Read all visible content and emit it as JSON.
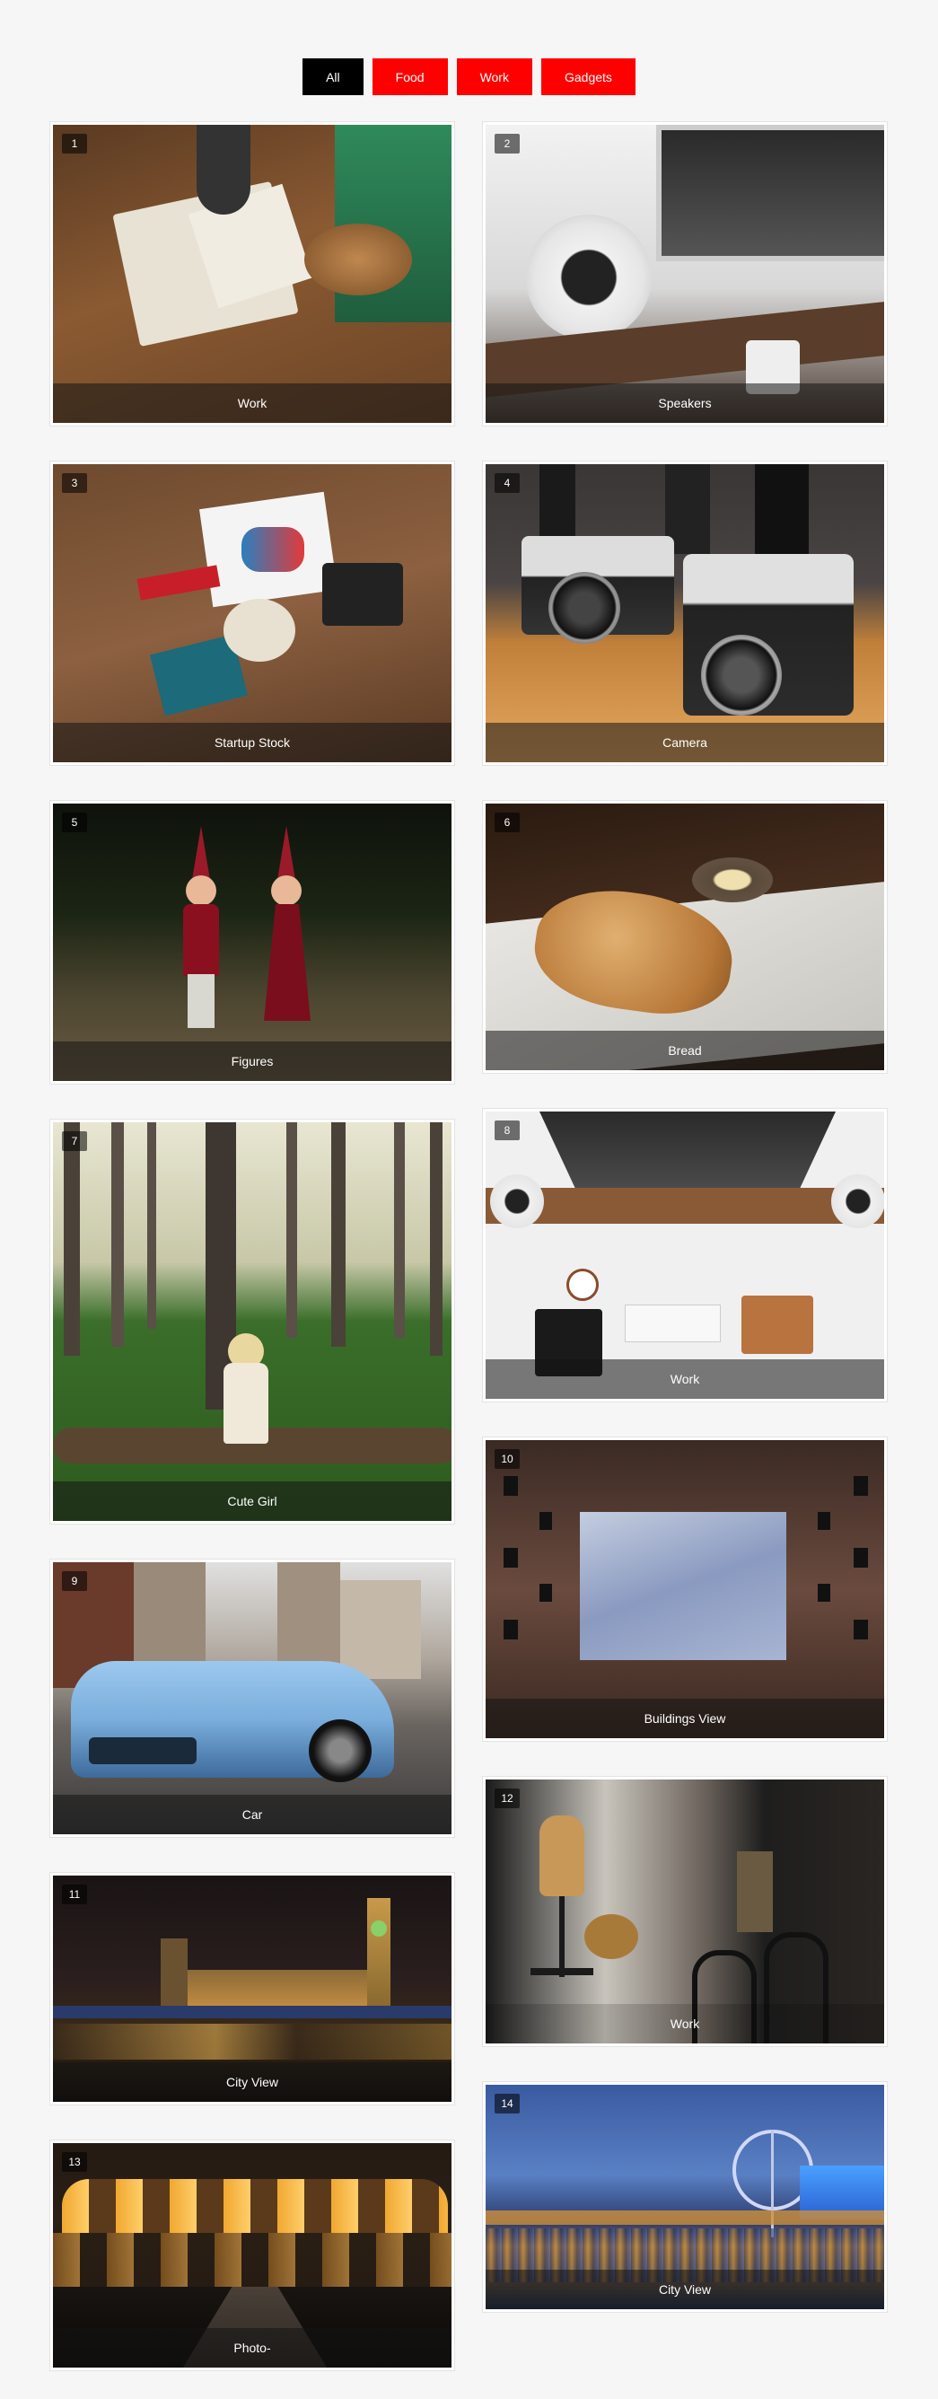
{
  "filters": [
    {
      "label": "All",
      "active": true
    },
    {
      "label": "Food",
      "active": false
    },
    {
      "label": "Work",
      "active": false
    },
    {
      "label": "Gadgets",
      "active": false
    }
  ],
  "items": [
    {
      "num": "1",
      "caption": "Work",
      "icon": "work-desk-image"
    },
    {
      "num": "2",
      "caption": "Speakers",
      "icon": "speakers-image"
    },
    {
      "num": "3",
      "caption": "Startup Stock",
      "icon": "startup-stock-image"
    },
    {
      "num": "4",
      "caption": "Camera",
      "icon": "camera-image"
    },
    {
      "num": "5",
      "caption": "Figures",
      "icon": "figures-image"
    },
    {
      "num": "6",
      "caption": "Bread",
      "icon": "bread-image"
    },
    {
      "num": "7",
      "caption": "Cute Girl",
      "icon": "cute-girl-image"
    },
    {
      "num": "8",
      "caption": "Work",
      "icon": "workspace-image"
    },
    {
      "num": "9",
      "caption": "Car",
      "icon": "car-image"
    },
    {
      "num": "10",
      "caption": "Buildings View",
      "icon": "buildings-view-image"
    },
    {
      "num": "11",
      "caption": "City View",
      "icon": "city-view-image"
    },
    {
      "num": "12",
      "caption": "Work",
      "icon": "mannequin-room-image"
    },
    {
      "num": "13",
      "caption": "Photo-",
      "icon": "arches-photo-image"
    },
    {
      "num": "14",
      "caption": "City View",
      "icon": "london-eye-image"
    }
  ]
}
